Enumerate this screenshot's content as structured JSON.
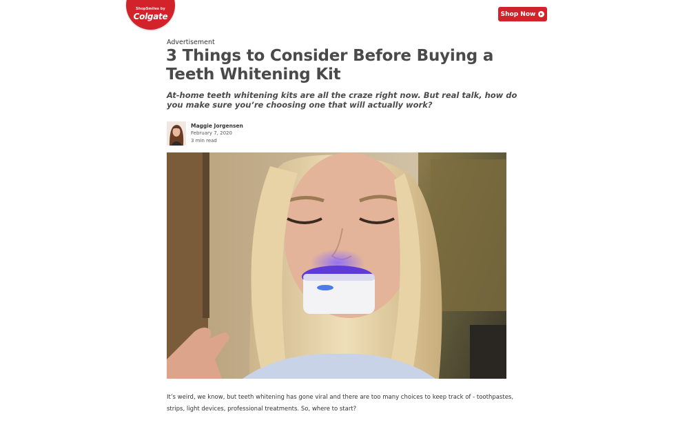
{
  "logo": {
    "tagline": "ShopSmiles by",
    "brand": "Colgate",
    "color": "#d2232a"
  },
  "header": {
    "shop_label": "Shop Now",
    "button_color": "#d2232a"
  },
  "article": {
    "ad_label": "Advertisement",
    "title": "3 Things to Consider Before Buying a Teeth Whitening Kit",
    "subtitle": "At-home teeth whitening kits are all the craze right now. But real talk, how do you make sure you’re choosing one that will actually work?",
    "author": {
      "name": "Maggie Jorgensen",
      "date": "February 7, 2020",
      "read_time": "3 min read"
    },
    "body": "It’s weird, we know, but teeth whitening has gone viral and there are too many choices to keep track of - toothpastes, strips, light devices, professional treatments. So, where to start?"
  }
}
